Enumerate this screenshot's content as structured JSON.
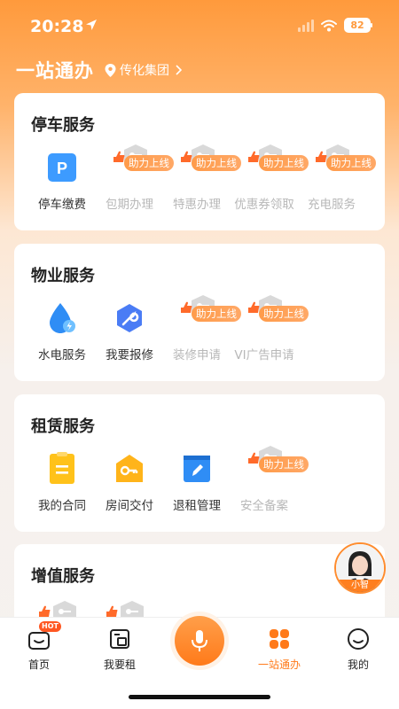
{
  "status": {
    "time": "20:28",
    "battery": "82"
  },
  "header": {
    "title": "一站通办",
    "location": "传化集团"
  },
  "sections": [
    {
      "title": "停车服务",
      "items": [
        {
          "label": "停车缴费",
          "icon": "parking-icon",
          "enabled": true
        },
        {
          "label": "包期办理",
          "icon": "placeholder-icon",
          "enabled": false,
          "badge": "助力上线"
        },
        {
          "label": "特惠办理",
          "icon": "placeholder-icon",
          "enabled": false,
          "badge": "助力上线"
        },
        {
          "label": "优惠券领取",
          "icon": "placeholder-icon",
          "enabled": false,
          "badge": "助力上线"
        },
        {
          "label": "充电服务",
          "icon": "placeholder-icon",
          "enabled": false,
          "badge": "助力上线"
        }
      ]
    },
    {
      "title": "物业服务",
      "items": [
        {
          "label": "水电服务",
          "icon": "water-drop-icon",
          "enabled": true
        },
        {
          "label": "我要报修",
          "icon": "wrench-icon",
          "enabled": true
        },
        {
          "label": "装修申请",
          "icon": "placeholder-icon",
          "enabled": false,
          "badge": "助力上线"
        },
        {
          "label": "VI广告申请",
          "icon": "placeholder-icon",
          "enabled": false,
          "badge": "助力上线"
        }
      ]
    },
    {
      "title": "租赁服务",
      "items": [
        {
          "label": "我的合同",
          "icon": "contract-icon",
          "enabled": true
        },
        {
          "label": "房间交付",
          "icon": "key-icon",
          "enabled": true
        },
        {
          "label": "退租管理",
          "icon": "edit-icon",
          "enabled": true
        },
        {
          "label": "安全备案",
          "icon": "placeholder-icon",
          "enabled": false,
          "badge": "助力上线"
        }
      ]
    },
    {
      "title": "增值服务",
      "items": []
    }
  ],
  "assistant": {
    "label": "小智"
  },
  "nav": {
    "home": "首页",
    "hot": "HOT",
    "rent": "我要租",
    "onestop": "一站通办",
    "mine": "我的"
  },
  "colors": {
    "accent": "#ff7a1a",
    "badge": "#ffa25a",
    "disabled_text": "#b8b8b8"
  }
}
